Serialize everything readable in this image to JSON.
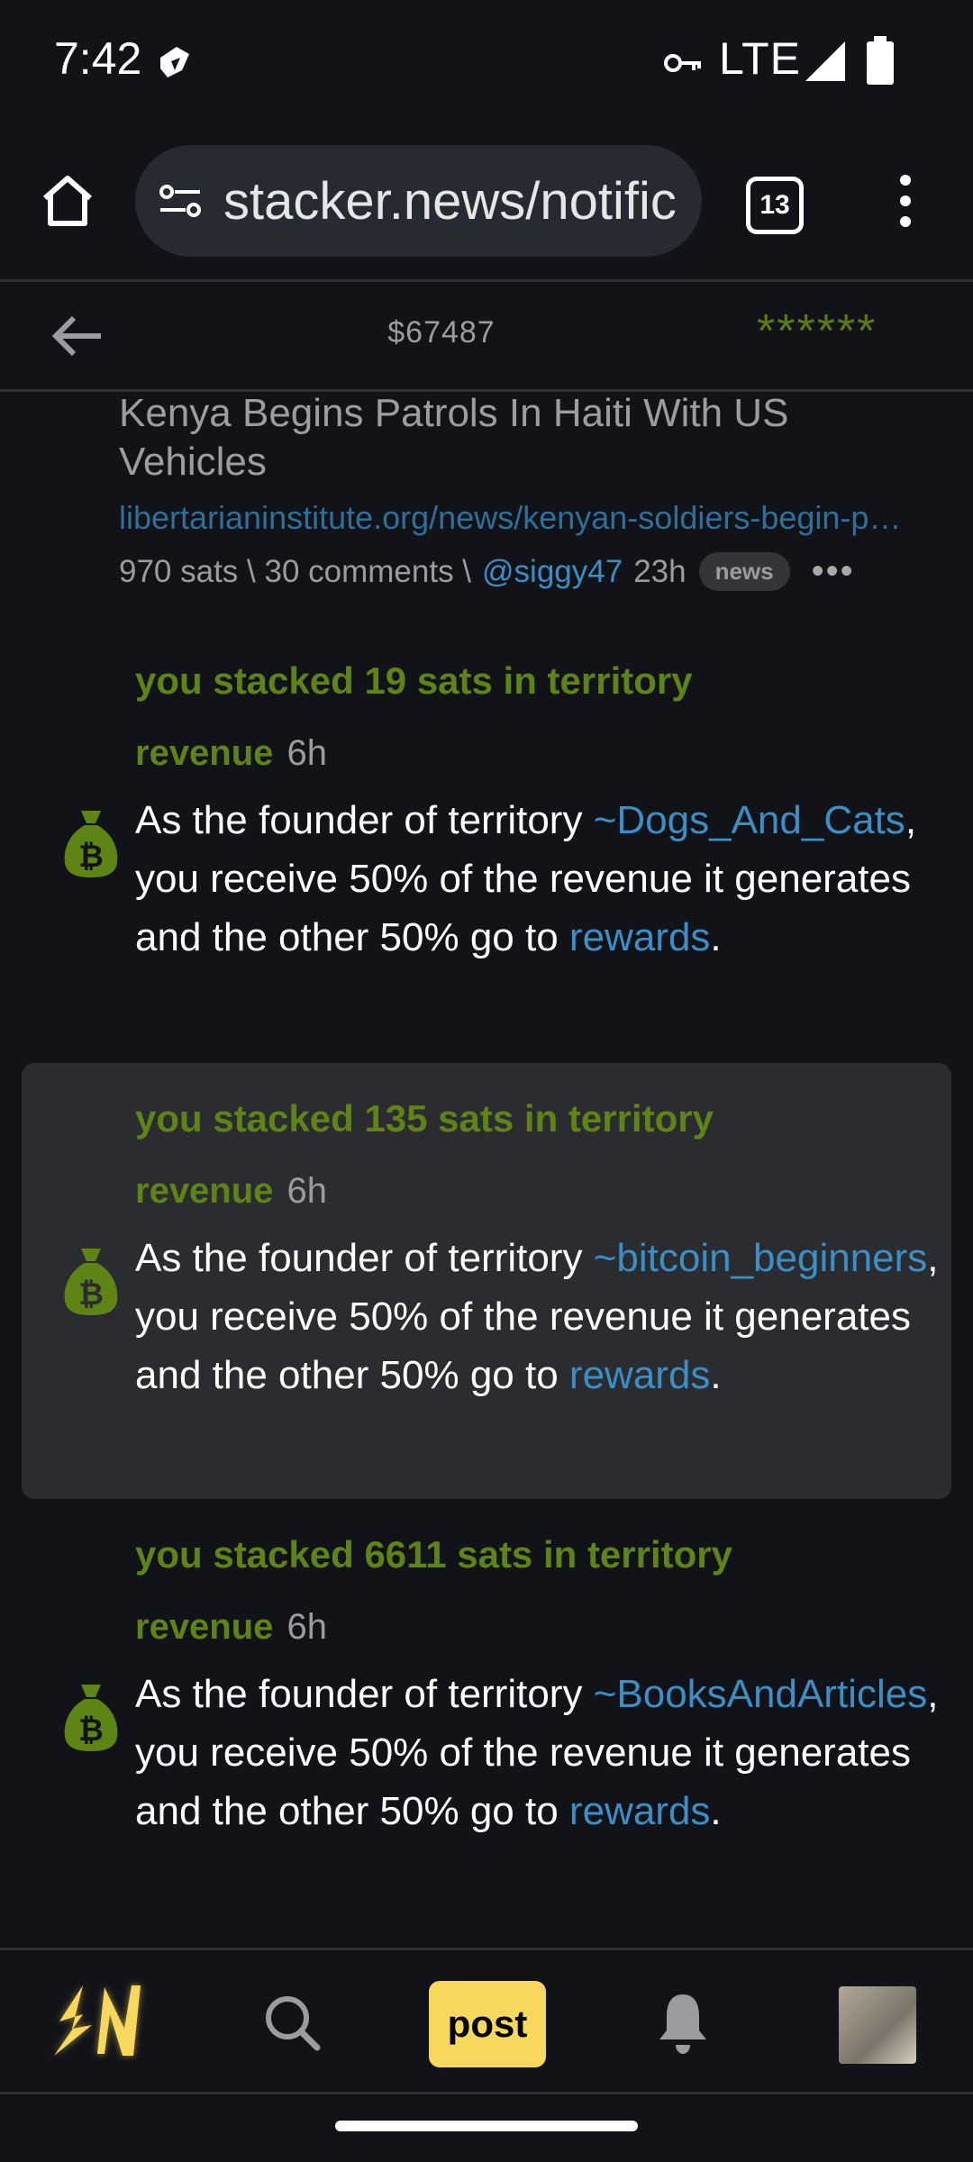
{
  "status_bar": {
    "time": "7:42",
    "network": "LTE"
  },
  "browser": {
    "url": "stacker.news/notific",
    "tab_count": "13"
  },
  "header": {
    "price": "$67487",
    "stars": "******"
  },
  "article": {
    "title": "Kenya Begins Patrols In Haiti With US Vehicles",
    "link": "libertarianinstitute.org/news/kenyan-soldiers-begin-p…",
    "meta_prefix": "970 sats \\ 30 comments \\",
    "user": "@siggy47",
    "age": "23h",
    "badge": "news"
  },
  "notifications": [
    {
      "title": "you stacked 19 sats in territory",
      "revenue_label": "revenue",
      "time": "6h",
      "text_a": "As the founder of territory ",
      "territory": "~Dogs_And_Cats",
      "text_b": ", you receive 50% of the revenue it generates and the other 50% go to ",
      "rewards": "rewards",
      "text_c": "."
    },
    {
      "title": "you stacked 135 sats in territory",
      "revenue_label": "revenue",
      "time": "6h",
      "text_a": "As the founder of territory ",
      "territory": "~bitcoin_beginners",
      "text_b": ", you receive 50% of the revenue it generates and the other 50% go to ",
      "rewards": "rewards",
      "text_c": "."
    },
    {
      "title": "you stacked 6611 sats in territory",
      "revenue_label": "revenue",
      "time": "6h",
      "text_a": "As the founder of territory ",
      "territory": "~BooksAndArticles",
      "text_b": ", you receive 50% of the revenue it generates and the other 50% go to ",
      "rewards": "rewards",
      "text_c": "."
    }
  ],
  "bottom_nav": {
    "post_label": "post"
  },
  "colors": {
    "background": "#121319",
    "accent_green": "#5e8416",
    "link_blue": "#3b8fc5",
    "post_yellow": "#f8d85c"
  }
}
